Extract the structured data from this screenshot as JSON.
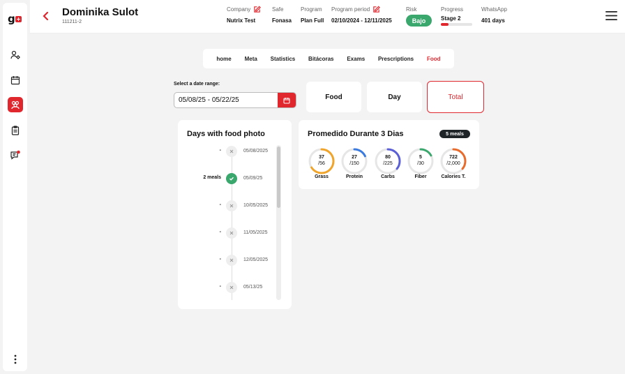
{
  "brand": {
    "logo_text": "g",
    "accent": "#e0272e",
    "success": "#3aa76d"
  },
  "sidebar": {
    "items": [
      {
        "icon": "user-settings-icon"
      },
      {
        "icon": "calendar-icon"
      },
      {
        "icon": "group-icon",
        "active": true
      },
      {
        "icon": "clipboard-icon"
      },
      {
        "icon": "chat-notification-icon"
      },
      {
        "icon": "more-vertical-icon"
      }
    ]
  },
  "patient": {
    "name": "Dominika Sulot",
    "id": "111211-2"
  },
  "header_meta": {
    "company_label": "Company",
    "company_value": "Nutrix Test",
    "safe_label": "Safe",
    "safe_value": "Fonasa",
    "program_label": "Program",
    "program_value": "Plan Full",
    "period_label": "Program period",
    "period_value": "02/10/2024 - 12/11/2025",
    "risk_label": "Risk",
    "risk_value": "Bajo",
    "progress_label": "Progress",
    "progress_value": "Stage 2",
    "progress_fraction": 0.25,
    "whatsapp_label": "WhatsApp",
    "whatsapp_value": "401 days"
  },
  "tabs": [
    "home",
    "Meta",
    "Statistics",
    "Bitácoras",
    "Exams",
    "Prescriptions",
    "Food"
  ],
  "active_tab": "Food",
  "date_range": {
    "label": "Select a date range:",
    "value": "05/08/25 - 05/22/25"
  },
  "modes": {
    "food": "Food",
    "day": "Day",
    "total": "Total",
    "active": "Total"
  },
  "photo_days": {
    "title": "Days with food photo",
    "entries": [
      {
        "meals": "-",
        "date": "05/08/2025",
        "has_photo": false
      },
      {
        "meals": "2 meals",
        "date": "05/09/25",
        "has_photo": true
      },
      {
        "meals": "-",
        "date": "10/05/2025",
        "has_photo": false
      },
      {
        "meals": "-",
        "date": "11/05/2025",
        "has_photo": false
      },
      {
        "meals": "-",
        "date": "12/05/2025",
        "has_photo": false
      },
      {
        "meals": "-",
        "date": "05/13/25",
        "has_photo": false
      }
    ]
  },
  "average": {
    "title": "Promedido Durante 3 Dias",
    "meals_badge": "5 meals",
    "nutrients": [
      {
        "value": "37",
        "target": "/56",
        "label": "Grass",
        "fraction": 0.66,
        "color": "#f0a52a"
      },
      {
        "value": "27",
        "target": "/150",
        "label": "Protein",
        "fraction": 0.18,
        "color": "#3b7be0"
      },
      {
        "value": "80",
        "target": "/225",
        "label": "Carbs",
        "fraction": 0.36,
        "color": "#5b5fd6"
      },
      {
        "value": "5",
        "target": "/30",
        "label": "Fiber",
        "fraction": 0.17,
        "color": "#3aa76d"
      },
      {
        "value": "722",
        "target": "/2,000",
        "label": "Calories T.",
        "fraction": 0.36,
        "color": "#e86b2b"
      }
    ]
  }
}
